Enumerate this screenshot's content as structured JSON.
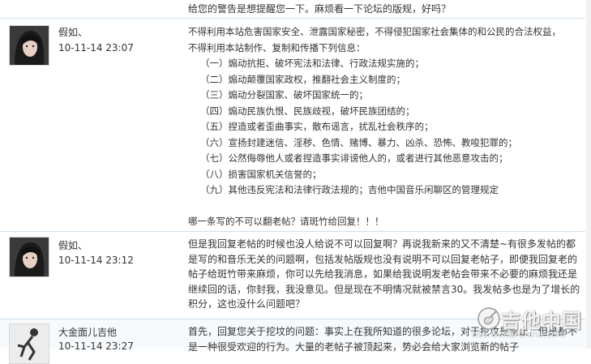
{
  "top_fragment": "给您的警告是想提醒您一下。麻烦看一下论坛的版规，好吗？",
  "posts": [
    {
      "user": "假如、",
      "date": "10-11-14 23:07",
      "lines": [
        "不得利用本站危害国家安全、泄露国家秘密，不得侵犯国家社会集体的和公民的合法权益，",
        "不得利用本站制作、复制和传播下列信息：",
        "（一）煽动抗拒、破坏宪法和法律、行政法规实施的；",
        "（二）煽动颠覆国家政权，推翻社会主义制度的；",
        "（三）煽动分裂国家、破坏国家统一的；",
        "（四）煽动民族仇恨、民族歧视，破坏民族团结的；",
        "（五）捏造或者歪曲事实，散布谣言，扰乱社会秩序的；",
        "（六）宣扬封建迷信、淫秽、色情、赌博、暴力、凶杀、恐怖、教唆犯罪的；",
        "（七）公然侮辱他人或者捏造事实诽谤他人的，或者进行其他恶意攻击的；",
        "（八）损害国家机关信誉的；",
        "（九）其他违反宪法和法律行政法规的；吉他中国音乐闲聊区的管理规定",
        "",
        "哪一条写的不可以翻老帖？请斑竹给回复！！！"
      ]
    },
    {
      "user": "假如、",
      "date": "10-11-14 23:12",
      "text": "但是我回复老帖的时候也没人给说不可以回复啊？再说我新来的又不清楚~有很多发帖的都是写的和音乐无关的问题啊，包括发帖版规也没有说明不可以回复老帖子，即便我回复老的帖子给斑竹带来麻烦，你可以先给我消息，如果给我说明发老帖会带来不必要的麻烦我还是继续回的话，你封我，我没意见。但是现在不明情况就被禁言30。我发帖多也是为了增长的积分，这也没什么问题吧？"
    },
    {
      "user": "大金面儿吉他",
      "date": "10-11-14 23:27",
      "text": "首先，回复您关于挖坟的问题：事实上在我所知道的很多论坛，对于挖坟是禁止，但是都不是一种很受欢迎的行为。大量的老帖子被顶起来，势必会给大家浏览新的帖子"
    }
  ],
  "watermark": {
    "title": "吉他中国",
    "url": "bbs.GuitarChina.com"
  }
}
